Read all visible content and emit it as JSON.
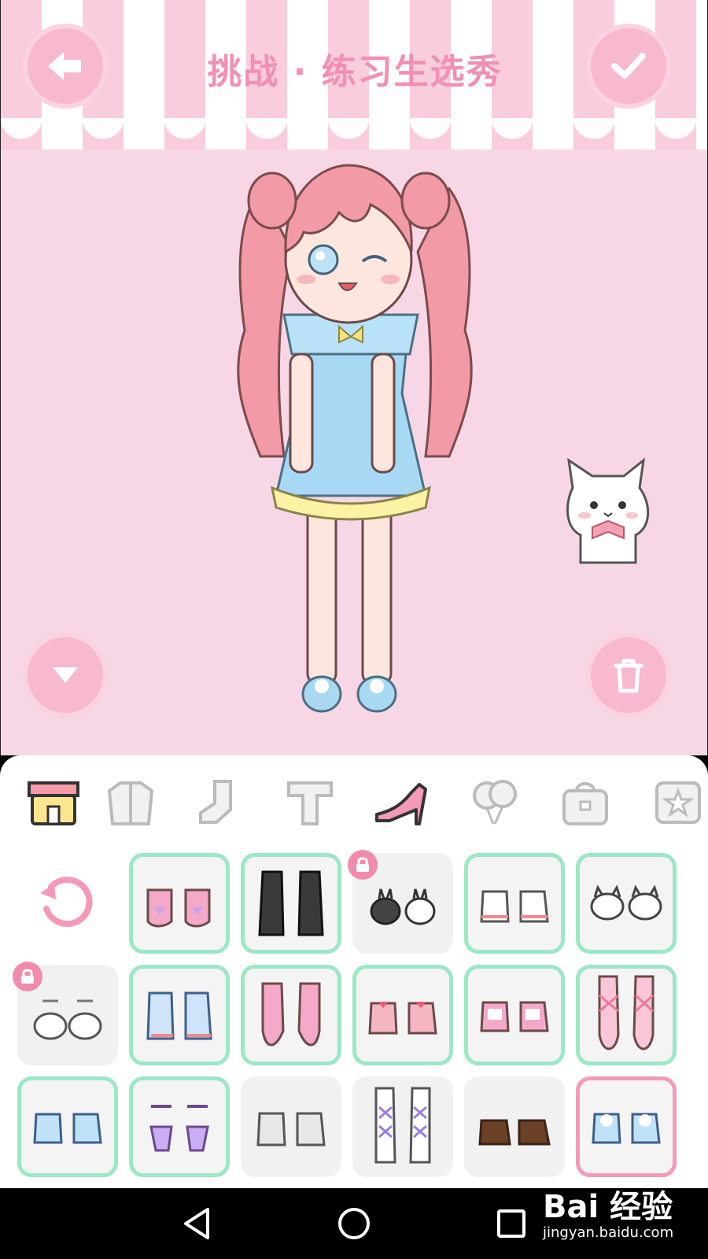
{
  "header": {
    "title": "挑战 · 练习生选秀",
    "back_icon": "arrow-left-icon",
    "confirm_icon": "check-icon"
  },
  "stage": {
    "collapse_icon": "triangle-down-icon",
    "delete_icon": "trash-icon"
  },
  "category_tabs": [
    {
      "name": "shop",
      "icon": "shop-icon",
      "selected": false
    },
    {
      "name": "coat",
      "icon": "jacket-icon",
      "selected": false
    },
    {
      "name": "socks",
      "icon": "sock-icon",
      "selected": false
    },
    {
      "name": "top",
      "icon": "shirt-icon",
      "selected": false
    },
    {
      "name": "shoes",
      "icon": "high-heel-icon",
      "selected": true
    },
    {
      "name": "balloons",
      "icon": "balloon-icon",
      "selected": false
    },
    {
      "name": "bag",
      "icon": "bag-icon",
      "selected": false
    },
    {
      "name": "badge",
      "icon": "star-badge-icon",
      "selected": false
    }
  ],
  "shoes_grid": {
    "reset_icon": "reset-icon",
    "items": [
      {
        "style": "pink-bow-flats",
        "locked": false,
        "selected": false
      },
      {
        "style": "black-boots",
        "locked": false,
        "selected": false
      },
      {
        "style": "bunny-slippers",
        "locked": true,
        "selected": false
      },
      {
        "style": "sneakers",
        "locked": false,
        "selected": false
      },
      {
        "style": "cat-slippers",
        "locked": false,
        "selected": false
      },
      {
        "style": "white-bow-sandals",
        "locked": true,
        "selected": false
      },
      {
        "style": "blue-sneakers",
        "locked": false,
        "selected": false
      },
      {
        "style": "pink-ballet-flats",
        "locked": false,
        "selected": false
      },
      {
        "style": "pink-bow-heels",
        "locked": false,
        "selected": false
      },
      {
        "style": "pink-loafers",
        "locked": false,
        "selected": false
      },
      {
        "style": "ballet-pointe",
        "locked": false,
        "selected": false
      },
      {
        "style": "blue-bunny-flats",
        "locked": false,
        "selected": false
      },
      {
        "style": "purple-flats",
        "locked": false,
        "selected": false
      },
      {
        "style": "grey-sneakers",
        "locked": false,
        "selected": false
      },
      {
        "style": "lace-up-boots",
        "locked": false,
        "selected": false
      },
      {
        "style": "brown-loafers",
        "locked": false,
        "selected": false
      },
      {
        "style": "blue-fluffy-slippers",
        "locked": false,
        "selected": true
      }
    ]
  },
  "navbar": {
    "back_icon": "nav-back-icon",
    "home_icon": "nav-home-icon",
    "recent_icon": "nav-recent-icon"
  },
  "watermark": {
    "logo": "Bai 经验",
    "url": "jingyan.baidu.com"
  },
  "colors": {
    "accent_pink": "#f8b8cf",
    "title_pink": "#f28fb3",
    "selected_green": "#9be7c7",
    "selected_pink": "#f39ab9"
  }
}
